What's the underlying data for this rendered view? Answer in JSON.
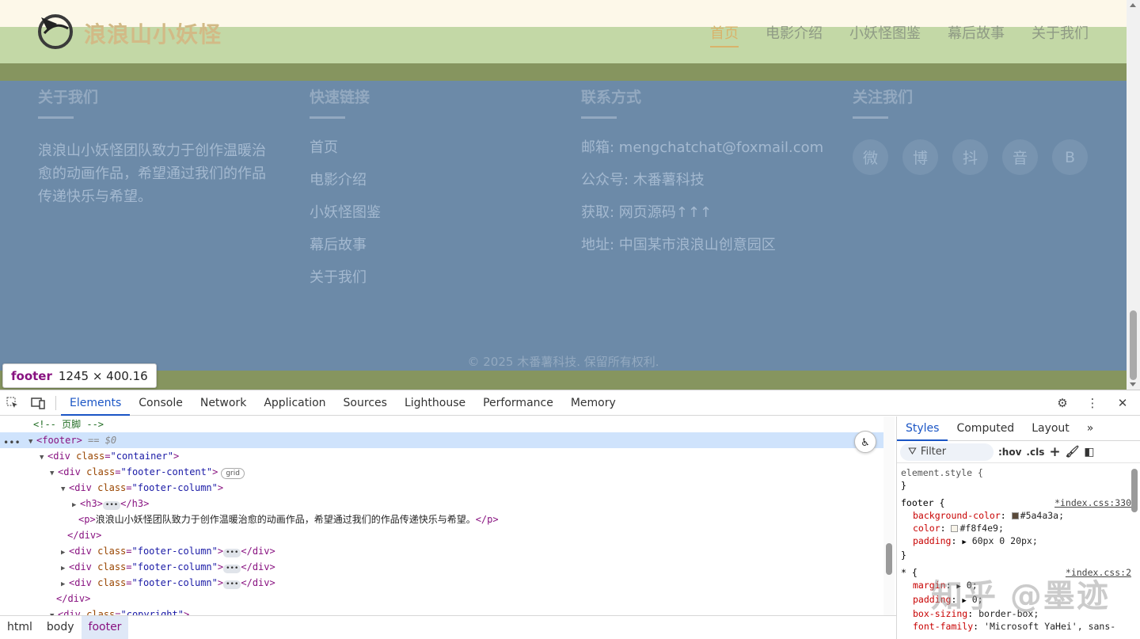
{
  "site": {
    "logo_text": "浪浪山小妖怪",
    "nav": [
      "首页",
      "电影介绍",
      "小妖怪图鉴",
      "幕后故事",
      "关于我们"
    ]
  },
  "footer": {
    "about": {
      "title": "关于我们",
      "text": "浪浪山小妖怪团队致力于创作温暖治愈的动画作品，希望通过我们的作品传递快乐与希望。"
    },
    "links": {
      "title": "快速链接",
      "items": [
        "首页",
        "电影介绍",
        "小妖怪图鉴",
        "幕后故事",
        "关于我们"
      ]
    },
    "contact": {
      "title": "联系方式",
      "items": [
        "邮箱: mengchatchat@foxmail.com",
        "公众号: 木番薯科技",
        "获取: 网页源码↑↑↑",
        "地址: 中国某市浪浪山创意园区"
      ]
    },
    "follow": {
      "title": "关注我们",
      "icons": [
        "微",
        "博",
        "抖",
        "音",
        "B"
      ]
    },
    "copyright": "© 2025 木番薯科技. 保留所有权利."
  },
  "tooltip": {
    "tag": "footer",
    "dims": "1245 × 400.16"
  },
  "devtools": {
    "tabs": [
      "Elements",
      "Console",
      "Network",
      "Application",
      "Sources",
      "Lighthouse",
      "Performance",
      "Memory"
    ],
    "dom": {
      "comment": "<!-- 页脚 -->",
      "footer_tag": "<footer>",
      "eq0": "== $0",
      "div_open": "<div",
      "gt": ">",
      "close_div": "</div>",
      "class_attr": "class",
      "container": "\"container\"",
      "footer_content": "\"footer-content\"",
      "footer_column": "\"footer-column\"",
      "copyright_cls": "\"copyright\"",
      "grid_badge": "grid",
      "h3_open": "<h3>",
      "h3_close": "</h3>",
      "ell": "•••",
      "p_open": "<p>",
      "p_text": "浪浪山小妖怪团队致力于创作温暖治愈的动画作品，希望通过我们的作品传递快乐与希望。",
      "p_close": "</p>"
    },
    "breadcrumbs": [
      "html",
      "body",
      "footer"
    ],
    "styles_tabs": [
      "Styles",
      "Computed",
      "Layout"
    ],
    "filter_placeholder": "Filter",
    "hov": ":hov",
    "cls": ".cls",
    "rules": {
      "element_style": "element.style {",
      "close": "}",
      "footer_sel": "footer {",
      "footer_src": "*index.css:330",
      "bg_prop": "background-color",
      "bg_val": "#5a4a3a;",
      "color_prop": "color",
      "color_val": "#f8f4e9;",
      "padding_prop": "padding",
      "padding_val": "60px 0 20px;",
      "star_sel": "* {",
      "star_src": "*index.css:2",
      "margin_prop": "margin",
      "margin_val": "0;",
      "padding2_val": "0;",
      "boxsizing_prop": "box-sizing",
      "boxsizing_val": "border-box;",
      "fontfamily_prop": "font-family",
      "fontfamily_val": "'Microsoft YaHei', sans-"
    }
  },
  "colors": {
    "bg_swatch": "#5a4a3a",
    "color_swatch": "#f8f4e9"
  },
  "watermark": "知乎 @墨迹"
}
